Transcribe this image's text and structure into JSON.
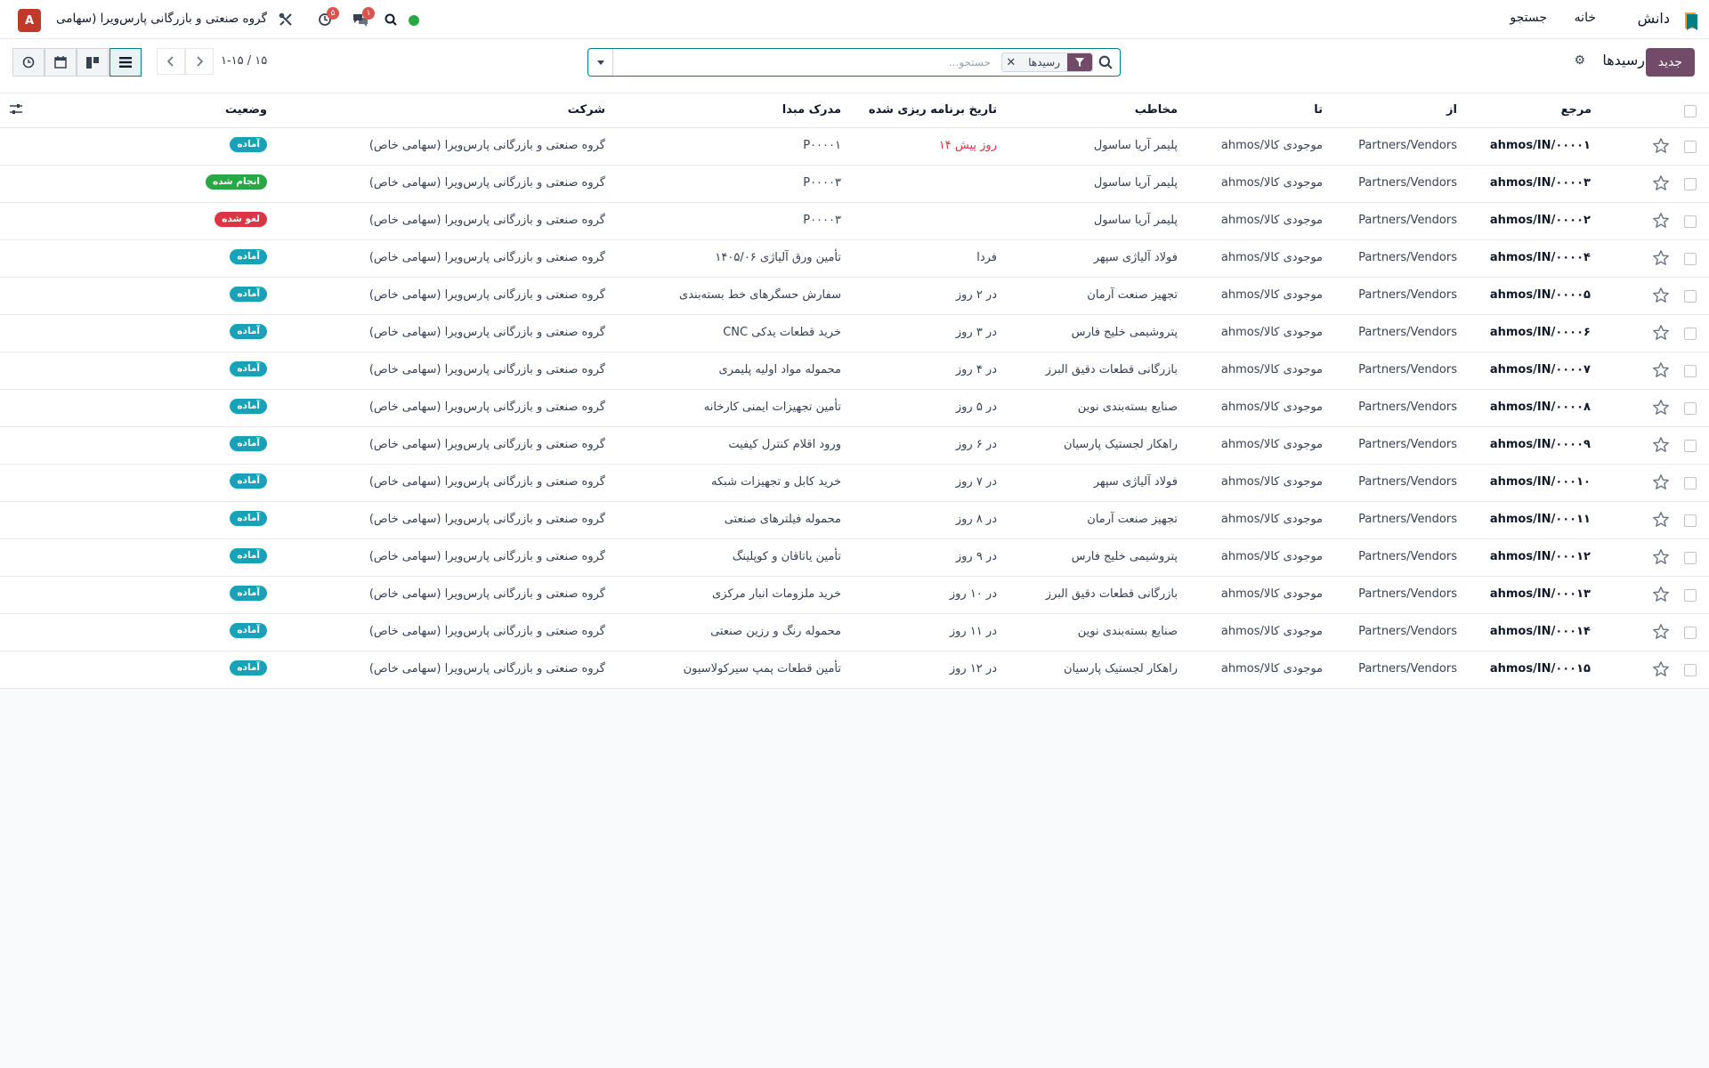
{
  "navbar": {
    "app_name": "دانش",
    "links": [
      "خانه",
      "جستجو"
    ],
    "company": "گروه صنعتی و بازرگانی پارس‌ویرا (سهامی ...",
    "avatar_letter": "A",
    "activity_badge": "۵",
    "chat_badge": "۱"
  },
  "control": {
    "new_label": "جدید",
    "breadcrumb": "رسیدها",
    "search_placeholder": "جستجو...",
    "facet_label": "رسیدها",
    "pager": "۱-۱۵ / ۱۵"
  },
  "colors": {
    "brand": "#714b67",
    "accent": "#017e84",
    "ready": "#17a2b8",
    "done": "#28a745",
    "cancel": "#dc3545"
  },
  "table": {
    "headers": {
      "reference": "مرجع",
      "from": "از",
      "to": "تا",
      "contact": "مخاطب",
      "scheduled": "تاریخ برنامه ریزی شده",
      "source": "مدرک مبدا",
      "company": "شرکت",
      "status": "وضعیت"
    },
    "rows": [
      {
        "ref": "ahmos/IN/۰۰۰۰۱",
        "from": "Partners/Vendors",
        "to": "ahmos/موجودی کالا",
        "contact": "پلیمر آریا ساسول",
        "date": "۱۴ روز پیش",
        "date_late": true,
        "source": "P۰۰۰۰۱",
        "company": "گروه صنعتی و بازرگانی پارس‌ویرا (سهامی خاص)",
        "status": "آماده",
        "status_kind": "ready"
      },
      {
        "ref": "ahmos/IN/۰۰۰۰۳",
        "from": "Partners/Vendors",
        "to": "ahmos/موجودی کالا",
        "contact": "پلیمر آریا ساسول",
        "date": "",
        "date_late": false,
        "source": "P۰۰۰۰۳",
        "company": "گروه صنعتی و بازرگانی پارس‌ویرا (سهامی خاص)",
        "status": "انجام شده",
        "status_kind": "done"
      },
      {
        "ref": "ahmos/IN/۰۰۰۰۲",
        "from": "Partners/Vendors",
        "to": "ahmos/موجودی کالا",
        "contact": "پلیمر آریا ساسول",
        "date": "",
        "date_late": false,
        "source": "P۰۰۰۰۳",
        "company": "گروه صنعتی و بازرگانی پارس‌ویرا (سهامی خاص)",
        "status": "لغو شده",
        "status_kind": "cancel"
      },
      {
        "ref": "ahmos/IN/۰۰۰۰۴",
        "from": "Partners/Vendors",
        "to": "ahmos/موجودی کالا",
        "contact": "فولاد آلیاژی سپهر",
        "date": "فردا",
        "date_late": false,
        "source": "تأمین ورق آلیاژی ۱۴۰۵/۰۶",
        "company": "گروه صنعتی و بازرگانی پارس‌ویرا (سهامی خاص)",
        "status": "آماده",
        "status_kind": "ready"
      },
      {
        "ref": "ahmos/IN/۰۰۰۰۵",
        "from": "Partners/Vendors",
        "to": "ahmos/موجودی کالا",
        "contact": "تجهیز صنعت آرمان",
        "date": "در ۲ روز",
        "date_late": false,
        "source": "سفارش حسگرهای خط بسته‌بندی",
        "company": "گروه صنعتی و بازرگانی پارس‌ویرا (سهامی خاص)",
        "status": "آماده",
        "status_kind": "ready"
      },
      {
        "ref": "ahmos/IN/۰۰۰۰۶",
        "from": "Partners/Vendors",
        "to": "ahmos/موجودی کالا",
        "contact": "پتروشیمی خلیج فارس",
        "date": "در ۳ روز",
        "date_late": false,
        "source": "خرید قطعات یدکی CNC",
        "company": "گروه صنعتی و بازرگانی پارس‌ویرا (سهامی خاص)",
        "status": "آماده",
        "status_kind": "ready"
      },
      {
        "ref": "ahmos/IN/۰۰۰۰۷",
        "from": "Partners/Vendors",
        "to": "ahmos/موجودی کالا",
        "contact": "بازرگانی قطعات دقیق البرز",
        "date": "در ۴ روز",
        "date_late": false,
        "source": "محموله مواد اولیه پلیمری",
        "company": "گروه صنعتی و بازرگانی پارس‌ویرا (سهامی خاص)",
        "status": "آماده",
        "status_kind": "ready"
      },
      {
        "ref": "ahmos/IN/۰۰۰۰۸",
        "from": "Partners/Vendors",
        "to": "ahmos/موجودی کالا",
        "contact": "صنایع بسته‌بندی نوین",
        "date": "در ۵ روز",
        "date_late": false,
        "source": "تأمین تجهیزات ایمنی کارخانه",
        "company": "گروه صنعتی و بازرگانی پارس‌ویرا (سهامی خاص)",
        "status": "آماده",
        "status_kind": "ready"
      },
      {
        "ref": "ahmos/IN/۰۰۰۰۹",
        "from": "Partners/Vendors",
        "to": "ahmos/موجودی کالا",
        "contact": "راهکار لجستیک پارسیان",
        "date": "در ۶ روز",
        "date_late": false,
        "source": "ورود اقلام کنترل کیفیت",
        "company": "گروه صنعتی و بازرگانی پارس‌ویرا (سهامی خاص)",
        "status": "آماده",
        "status_kind": "ready"
      },
      {
        "ref": "ahmos/IN/۰۰۰۱۰",
        "from": "Partners/Vendors",
        "to": "ahmos/موجودی کالا",
        "contact": "فولاد آلیاژی سپهر",
        "date": "در ۷ روز",
        "date_late": false,
        "source": "خرید کابل و تجهیزات شبکه",
        "company": "گروه صنعتی و بازرگانی پارس‌ویرا (سهامی خاص)",
        "status": "آماده",
        "status_kind": "ready"
      },
      {
        "ref": "ahmos/IN/۰۰۰۱۱",
        "from": "Partners/Vendors",
        "to": "ahmos/موجودی کالا",
        "contact": "تجهیز صنعت آرمان",
        "date": "در ۸ روز",
        "date_late": false,
        "source": "محموله فیلترهای صنعتی",
        "company": "گروه صنعتی و بازرگانی پارس‌ویرا (سهامی خاص)",
        "status": "آماده",
        "status_kind": "ready"
      },
      {
        "ref": "ahmos/IN/۰۰۰۱۲",
        "from": "Partners/Vendors",
        "to": "ahmos/موجودی کالا",
        "contact": "پتروشیمی خلیج فارس",
        "date": "در ۹ روز",
        "date_late": false,
        "source": "تأمین یاتاقان و کوپلینگ",
        "company": "گروه صنعتی و بازرگانی پارس‌ویرا (سهامی خاص)",
        "status": "آماده",
        "status_kind": "ready"
      },
      {
        "ref": "ahmos/IN/۰۰۰۱۳",
        "from": "Partners/Vendors",
        "to": "ahmos/موجودی کالا",
        "contact": "بازرگانی قطعات دقیق البرز",
        "date": "در ۱۰ روز",
        "date_late": false,
        "source": "خرید ملزومات انبار مرکزی",
        "company": "گروه صنعتی و بازرگانی پارس‌ویرا (سهامی خاص)",
        "status": "آماده",
        "status_kind": "ready"
      },
      {
        "ref": "ahmos/IN/۰۰۰۱۴",
        "from": "Partners/Vendors",
        "to": "ahmos/موجودی کالا",
        "contact": "صنایع بسته‌بندی نوین",
        "date": "در ۱۱ روز",
        "date_late": false,
        "source": "محموله رنگ و رزین صنعتی",
        "company": "گروه صنعتی و بازرگانی پارس‌ویرا (سهامی خاص)",
        "status": "آماده",
        "status_kind": "ready"
      },
      {
        "ref": "ahmos/IN/۰۰۰۱۵",
        "from": "Partners/Vendors",
        "to": "ahmos/موجودی کالا",
        "contact": "راهکار لجستیک پارسیان",
        "date": "در ۱۲ روز",
        "date_late": false,
        "source": "تأمین قطعات پمپ سیرکولاسیون",
        "company": "گروه صنعتی و بازرگانی پارس‌ویرا (سهامی خاص)",
        "status": "آماده",
        "status_kind": "ready"
      }
    ]
  }
}
